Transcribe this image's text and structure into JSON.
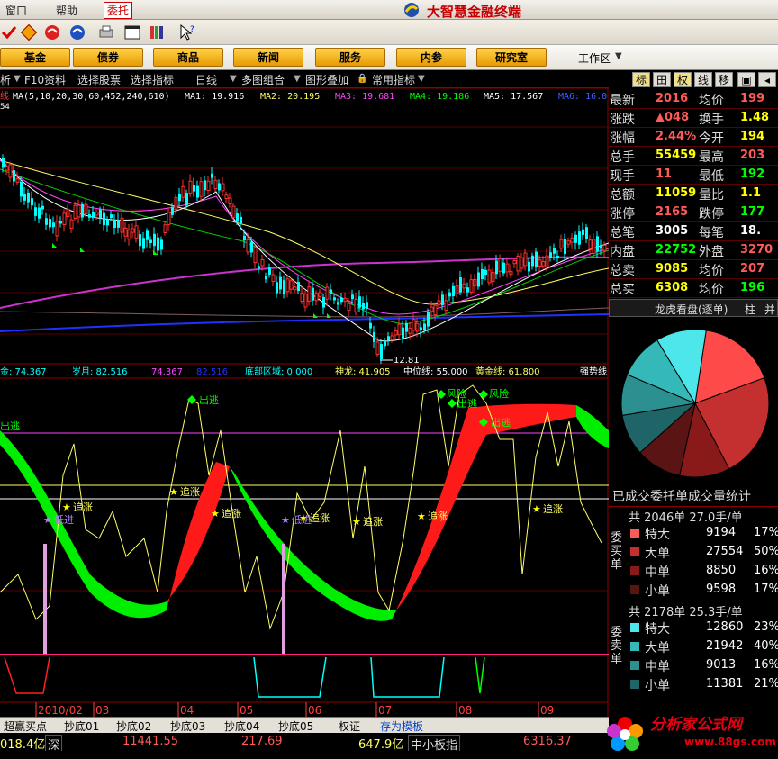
{
  "menu": {
    "window": "窗口",
    "help": "帮助",
    "order": "委托",
    "app_title": "大智慧金融终端"
  },
  "market_nav": {
    "buttons": [
      "基金",
      "债券",
      "商品",
      "新闻",
      "服务",
      "内参",
      "研究室"
    ],
    "workarea": "工作区"
  },
  "funcbar": {
    "items": [
      "析",
      "F10资料",
      "选择股票",
      "选择指标",
      "日线",
      "多图组合",
      "图形叠加",
      "常用指标"
    ]
  },
  "right_tabs": [
    "标",
    "田",
    "权",
    "线",
    "移",
    "",
    ""
  ],
  "main_chart": {
    "ma_header": {
      "prefix": "MA(5,10,20,30,60,452,240,610)",
      "ma1": "MA1: 19.916",
      "ma2": "MA2: 20.195",
      "ma3": "MA3: 19.681",
      "ma4": "MA4: 19.186",
      "ma5": "MA5: 17.567",
      "ma6": "MA6: 16.0"
    },
    "low_label": "12.81",
    "left_marks": [
      "线",
      "54"
    ]
  },
  "indicator": {
    "header": {
      "a": "金: 74.367",
      "b": "岁月: 82.516",
      "c": "74.367",
      "d": "82.516",
      "e": "底部区域: 0.000",
      "f": "神龙: 41.905",
      "g": "中位线: 55.000",
      "h": "黄金线: 61.800",
      "i": "强势线"
    },
    "signals": {
      "escape": "出逃",
      "chase": "追涨",
      "low_buy": "低进",
      "risk": "风险"
    }
  },
  "xaxis": [
    "2010/02",
    "03",
    "04",
    "05",
    "06",
    "07",
    "08",
    "09"
  ],
  "quote": {
    "rows": [
      {
        "l1": "最新",
        "v1": "2016",
        "c1": "#ff5a5a",
        "l2": "均价",
        "v2": "199",
        "c2": "#ff5a5a"
      },
      {
        "l1": "涨跌",
        "v1": "▲048",
        "c1": "#ff5a5a",
        "l2": "换手",
        "v2": "1.48",
        "c2": "#ffff00"
      },
      {
        "l1": "涨幅",
        "v1": "2.44%",
        "c1": "#ff5a5a",
        "l2": "今开",
        "v2": "194",
        "c2": "#ffff00"
      },
      {
        "l1": "总手",
        "v1": "55459",
        "c1": "#ffff00",
        "l2": "最高",
        "v2": "203",
        "c2": "#ff5a5a"
      },
      {
        "l1": "现手",
        "v1": "11",
        "c1": "#ff5a5a",
        "l2": "最低",
        "v2": "192",
        "c2": "#00ff00"
      },
      {
        "l1": "总额",
        "v1": "11059",
        "c1": "#ffff00",
        "l2": "量比",
        "v2": "1.1",
        "c2": "#ffff00"
      },
      {
        "l1": "涨停",
        "v1": "2165",
        "c1": "#ff5a5a",
        "l2": "跌停",
        "v2": "177",
        "c2": "#00ff00"
      },
      {
        "l1": "总笔",
        "v1": "3005",
        "c1": "#ffffff",
        "l2": "每笔",
        "v2": "18.",
        "c2": "#ffffff"
      },
      {
        "l1": "内盘",
        "v1": "22752",
        "c1": "#00ff00",
        "l2": "外盘",
        "v2": "3270",
        "c2": "#ff5a5a"
      },
      {
        "l1": "总卖",
        "v1": "9085",
        "c1": "#ffff00",
        "l2": "均价",
        "v2": "207",
        "c2": "#ff5a5a"
      },
      {
        "l1": "总买",
        "v1": "6308",
        "c1": "#ffff00",
        "l2": "均价",
        "v2": "196",
        "c2": "#00ff00"
      }
    ]
  },
  "dragon": {
    "title": "龙虎看盘(逐单)",
    "tab1": "柱",
    "tab2": "并"
  },
  "pie": {
    "slices": [
      {
        "value": 17,
        "color": "#ff4a4a"
      },
      {
        "value": 23,
        "color": "#c43030"
      },
      {
        "value": 11,
        "color": "#8a1a1a"
      },
      {
        "value": 10,
        "color": "#5a1414"
      },
      {
        "value": 9,
        "color": "#1f6466"
      },
      {
        "value": 9,
        "color": "#2c8f90"
      },
      {
        "value": 10,
        "color": "#35b8b8"
      },
      {
        "value": 11,
        "color": "#4de6ea"
      }
    ]
  },
  "stats": {
    "title": "已成交委托单成交量统计",
    "buy": {
      "head": "共 2046单 27.0手/单",
      "label": "委买单",
      "rows": [
        {
          "name": "特大",
          "vol": "9194",
          "pct": "17%",
          "color": "#ff5a5a"
        },
        {
          "name": "大单",
          "vol": "27554",
          "pct": "50%",
          "color": "#c43030"
        },
        {
          "name": "中单",
          "vol": "8850",
          "pct": "16%",
          "color": "#8a1a1a"
        },
        {
          "name": "小单",
          "vol": "9598",
          "pct": "17%",
          "color": "#5a1414"
        }
      ]
    },
    "sell": {
      "head": "共 2178单 25.3手/单",
      "label": "委卖单",
      "rows": [
        {
          "name": "特大",
          "vol": "12860",
          "pct": "23%",
          "color": "#4de6ea"
        },
        {
          "name": "大单",
          "vol": "21942",
          "pct": "40%",
          "color": "#35b8b8"
        },
        {
          "name": "中单",
          "vol": "9013",
          "pct": "16%",
          "color": "#2c8f90"
        },
        {
          "name": "小单",
          "vol": "11381",
          "pct": "21%",
          "color": "#1f6466"
        }
      ]
    }
  },
  "bottom_tabs": [
    "超赢买点",
    "抄底01",
    "抄底02",
    "抄底03",
    "抄底04",
    "抄底05",
    "权证",
    "存为模板"
  ],
  "status": {
    "a": "018.4亿",
    "b": "深",
    "c": "11441.55",
    "d": "217.69",
    "e": "647.9亿",
    "f": "中小板指",
    "g": "6316.37"
  },
  "watermark": {
    "name": "分析家公式网",
    "url": "www.88gs.com"
  },
  "colors": {
    "up": "#ff3030",
    "down": "#00ffff",
    "ma_purple": "#cc33cc",
    "band_green": "#00ee00",
    "band_red": "#ff1a1a"
  }
}
